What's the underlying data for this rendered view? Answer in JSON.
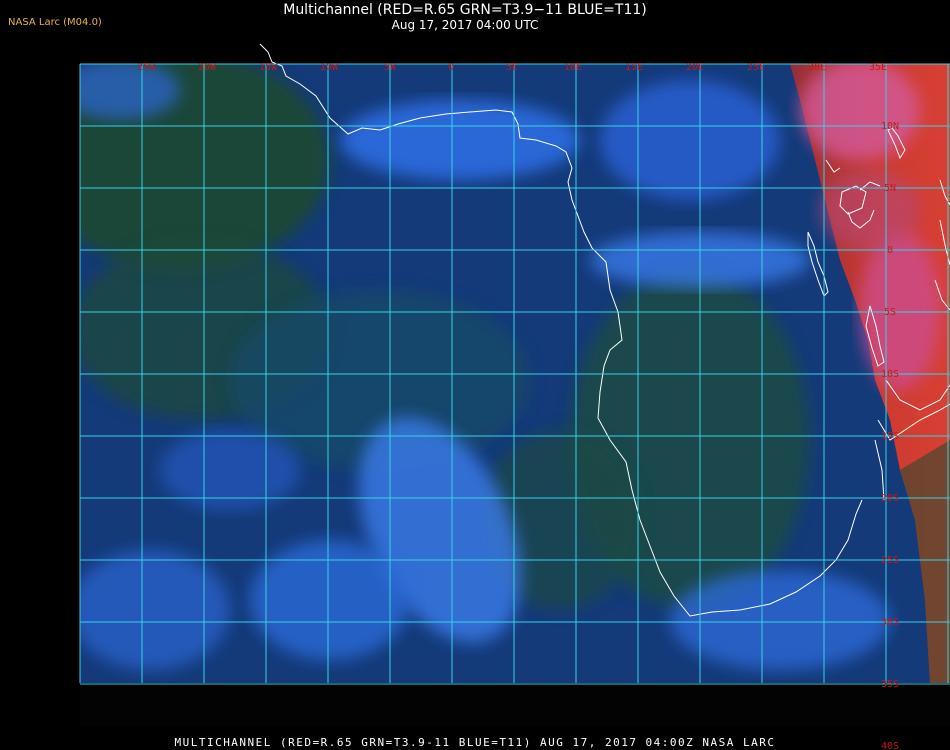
{
  "producer_label": "NASA Larc (M04.0)",
  "title": "Multichannel (RED=R.65 GRN=T3.9−11 BLUE=T11)",
  "subtitle": "Aug 17, 2017 04:00 UTC",
  "footer": "MULTICHANNEL (RED=R.65 GRN=T3.9-11 BLUE=T11) AUG 17, 2017 04:00Z   NASA LARC",
  "grid_color": "#38d2e6",
  "coast_color": "#ffffff",
  "label_color": "#c81818",
  "longitude_labels": [
    "25W",
    "20W",
    "15W",
    "10W",
    "5W",
    "0",
    "5E",
    "10E",
    "15E",
    "20E",
    "25E",
    "30E",
    "35E"
  ],
  "latitude_labels": [
    "10N",
    "5N",
    "0",
    "5S",
    "10S",
    "15S",
    "20S",
    "25S",
    "30S",
    "35S",
    "40S"
  ]
}
